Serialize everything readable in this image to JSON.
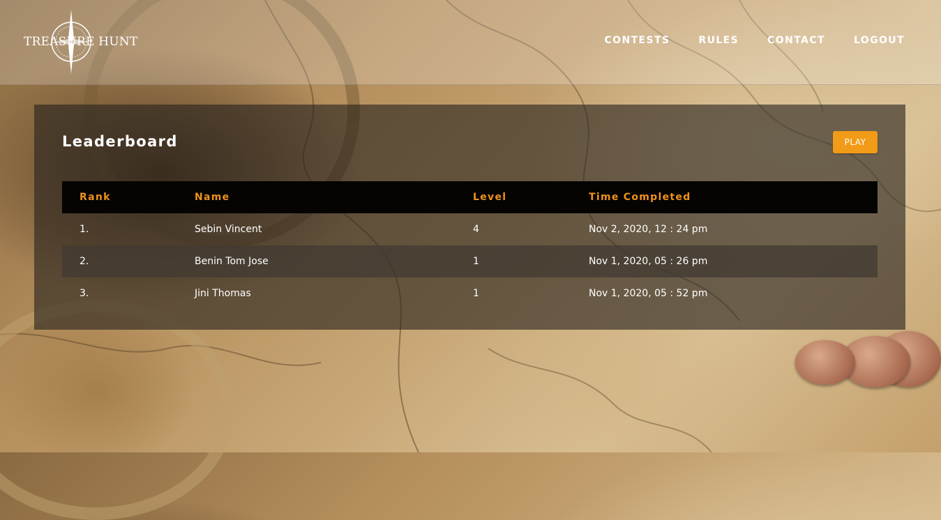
{
  "brand": {
    "name": "Treasure Hunt",
    "logo_icon": "compass-rose-icon"
  },
  "nav": {
    "items": [
      {
        "label": "CONTESTS"
      },
      {
        "label": "RULES"
      },
      {
        "label": "CONTACT"
      },
      {
        "label": "LOGOUT"
      }
    ]
  },
  "leaderboard": {
    "title": "Leaderboard",
    "play_label": "PLAY",
    "columns": [
      "Rank",
      "Name",
      "Level",
      "Time Completed"
    ],
    "rows": [
      {
        "rank": "1.",
        "name": "Sebin Vincent",
        "level": "4",
        "time": "Nov 2, 2020, 12 : 24 pm"
      },
      {
        "rank": "2.",
        "name": "Benin Tom Jose",
        "level": "1",
        "time": "Nov 1, 2020, 05 : 26 pm"
      },
      {
        "rank": "3.",
        "name": "Jini Thomas",
        "level": "1",
        "time": "Nov 1, 2020, 05 : 52 pm"
      }
    ]
  },
  "colors": {
    "accent": "#f29b18",
    "header_text": "#f0921c",
    "table_head_bg": "#050403"
  }
}
